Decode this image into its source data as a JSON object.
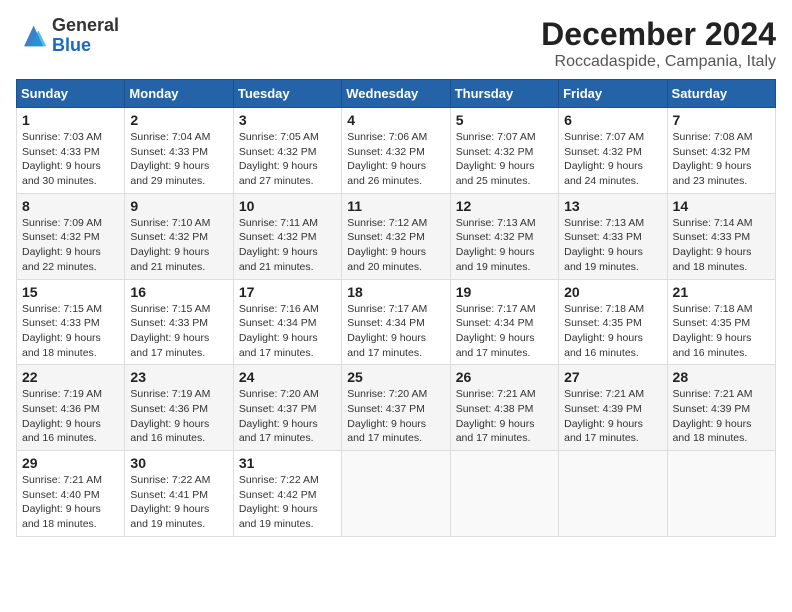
{
  "logo": {
    "general": "General",
    "blue": "Blue"
  },
  "title": "December 2024",
  "subtitle": "Roccadaspide, Campania, Italy",
  "weekdays": [
    "Sunday",
    "Monday",
    "Tuesday",
    "Wednesday",
    "Thursday",
    "Friday",
    "Saturday"
  ],
  "weeks": [
    [
      {
        "day": "1",
        "sunrise": "Sunrise: 7:03 AM",
        "sunset": "Sunset: 4:33 PM",
        "daylight": "Daylight: 9 hours and 30 minutes."
      },
      {
        "day": "2",
        "sunrise": "Sunrise: 7:04 AM",
        "sunset": "Sunset: 4:33 PM",
        "daylight": "Daylight: 9 hours and 29 minutes."
      },
      {
        "day": "3",
        "sunrise": "Sunrise: 7:05 AM",
        "sunset": "Sunset: 4:32 PM",
        "daylight": "Daylight: 9 hours and 27 minutes."
      },
      {
        "day": "4",
        "sunrise": "Sunrise: 7:06 AM",
        "sunset": "Sunset: 4:32 PM",
        "daylight": "Daylight: 9 hours and 26 minutes."
      },
      {
        "day": "5",
        "sunrise": "Sunrise: 7:07 AM",
        "sunset": "Sunset: 4:32 PM",
        "daylight": "Daylight: 9 hours and 25 minutes."
      },
      {
        "day": "6",
        "sunrise": "Sunrise: 7:07 AM",
        "sunset": "Sunset: 4:32 PM",
        "daylight": "Daylight: 9 hours and 24 minutes."
      },
      {
        "day": "7",
        "sunrise": "Sunrise: 7:08 AM",
        "sunset": "Sunset: 4:32 PM",
        "daylight": "Daylight: 9 hours and 23 minutes."
      }
    ],
    [
      {
        "day": "8",
        "sunrise": "Sunrise: 7:09 AM",
        "sunset": "Sunset: 4:32 PM",
        "daylight": "Daylight: 9 hours and 22 minutes."
      },
      {
        "day": "9",
        "sunrise": "Sunrise: 7:10 AM",
        "sunset": "Sunset: 4:32 PM",
        "daylight": "Daylight: 9 hours and 21 minutes."
      },
      {
        "day": "10",
        "sunrise": "Sunrise: 7:11 AM",
        "sunset": "Sunset: 4:32 PM",
        "daylight": "Daylight: 9 hours and 21 minutes."
      },
      {
        "day": "11",
        "sunrise": "Sunrise: 7:12 AM",
        "sunset": "Sunset: 4:32 PM",
        "daylight": "Daylight: 9 hours and 20 minutes."
      },
      {
        "day": "12",
        "sunrise": "Sunrise: 7:13 AM",
        "sunset": "Sunset: 4:32 PM",
        "daylight": "Daylight: 9 hours and 19 minutes."
      },
      {
        "day": "13",
        "sunrise": "Sunrise: 7:13 AM",
        "sunset": "Sunset: 4:33 PM",
        "daylight": "Daylight: 9 hours and 19 minutes."
      },
      {
        "day": "14",
        "sunrise": "Sunrise: 7:14 AM",
        "sunset": "Sunset: 4:33 PM",
        "daylight": "Daylight: 9 hours and 18 minutes."
      }
    ],
    [
      {
        "day": "15",
        "sunrise": "Sunrise: 7:15 AM",
        "sunset": "Sunset: 4:33 PM",
        "daylight": "Daylight: 9 hours and 18 minutes."
      },
      {
        "day": "16",
        "sunrise": "Sunrise: 7:15 AM",
        "sunset": "Sunset: 4:33 PM",
        "daylight": "Daylight: 9 hours and 17 minutes."
      },
      {
        "day": "17",
        "sunrise": "Sunrise: 7:16 AM",
        "sunset": "Sunset: 4:34 PM",
        "daylight": "Daylight: 9 hours and 17 minutes."
      },
      {
        "day": "18",
        "sunrise": "Sunrise: 7:17 AM",
        "sunset": "Sunset: 4:34 PM",
        "daylight": "Daylight: 9 hours and 17 minutes."
      },
      {
        "day": "19",
        "sunrise": "Sunrise: 7:17 AM",
        "sunset": "Sunset: 4:34 PM",
        "daylight": "Daylight: 9 hours and 17 minutes."
      },
      {
        "day": "20",
        "sunrise": "Sunrise: 7:18 AM",
        "sunset": "Sunset: 4:35 PM",
        "daylight": "Daylight: 9 hours and 16 minutes."
      },
      {
        "day": "21",
        "sunrise": "Sunrise: 7:18 AM",
        "sunset": "Sunset: 4:35 PM",
        "daylight": "Daylight: 9 hours and 16 minutes."
      }
    ],
    [
      {
        "day": "22",
        "sunrise": "Sunrise: 7:19 AM",
        "sunset": "Sunset: 4:36 PM",
        "daylight": "Daylight: 9 hours and 16 minutes."
      },
      {
        "day": "23",
        "sunrise": "Sunrise: 7:19 AM",
        "sunset": "Sunset: 4:36 PM",
        "daylight": "Daylight: 9 hours and 16 minutes."
      },
      {
        "day": "24",
        "sunrise": "Sunrise: 7:20 AM",
        "sunset": "Sunset: 4:37 PM",
        "daylight": "Daylight: 9 hours and 17 minutes."
      },
      {
        "day": "25",
        "sunrise": "Sunrise: 7:20 AM",
        "sunset": "Sunset: 4:37 PM",
        "daylight": "Daylight: 9 hours and 17 minutes."
      },
      {
        "day": "26",
        "sunrise": "Sunrise: 7:21 AM",
        "sunset": "Sunset: 4:38 PM",
        "daylight": "Daylight: 9 hours and 17 minutes."
      },
      {
        "day": "27",
        "sunrise": "Sunrise: 7:21 AM",
        "sunset": "Sunset: 4:39 PM",
        "daylight": "Daylight: 9 hours and 17 minutes."
      },
      {
        "day": "28",
        "sunrise": "Sunrise: 7:21 AM",
        "sunset": "Sunset: 4:39 PM",
        "daylight": "Daylight: 9 hours and 18 minutes."
      }
    ],
    [
      {
        "day": "29",
        "sunrise": "Sunrise: 7:21 AM",
        "sunset": "Sunset: 4:40 PM",
        "daylight": "Daylight: 9 hours and 18 minutes."
      },
      {
        "day": "30",
        "sunrise": "Sunrise: 7:22 AM",
        "sunset": "Sunset: 4:41 PM",
        "daylight": "Daylight: 9 hours and 19 minutes."
      },
      {
        "day": "31",
        "sunrise": "Sunrise: 7:22 AM",
        "sunset": "Sunset: 4:42 PM",
        "daylight": "Daylight: 9 hours and 19 minutes."
      },
      null,
      null,
      null,
      null
    ]
  ]
}
